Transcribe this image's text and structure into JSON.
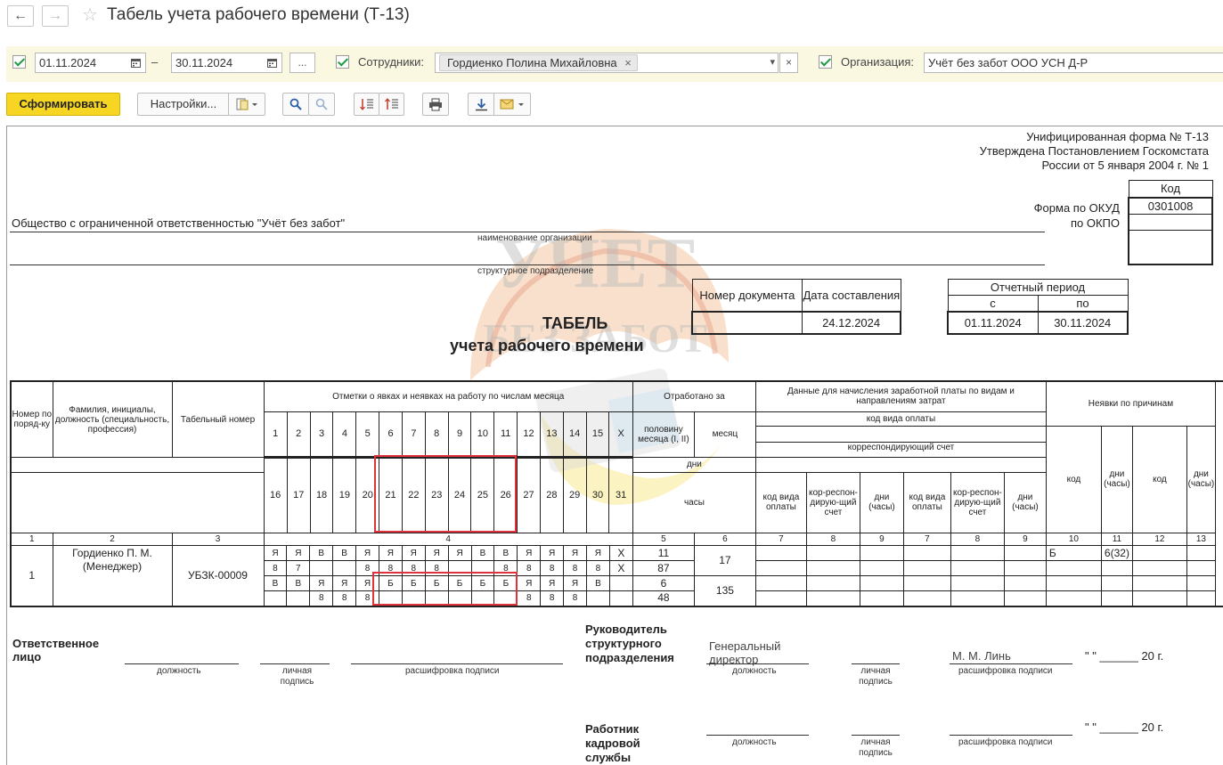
{
  "window": {
    "title": "Табель учета рабочего времени (Т-13)"
  },
  "nav": {
    "back": "←",
    "forward": "→",
    "fav": "☆"
  },
  "filters": {
    "date_from": "01.11.2024",
    "date_sep": "–",
    "date_to": "30.11.2024",
    "period_more": "...",
    "employees_label": "Сотрудники:",
    "employee_tag": "Гордиенко Полина Михайловна",
    "tag_remove": "×",
    "dropdown": "▾",
    "clear": "×",
    "org_label": "Организация:",
    "org_value": "Учёт без забот ООО УСН Д-Р"
  },
  "toolbar": {
    "form": "Сформировать",
    "settings": "Настройки..."
  },
  "report": {
    "form_line1": "Унифицированная форма № Т-13",
    "form_line2": "Утверждена Постановлением Госкомстата",
    "form_line3": "России от 5 января 2004 г. № 1",
    "kod": "Код",
    "okud_label": "Форма по ОКУД",
    "okud_value": "0301008",
    "okpo_label": "по ОКПО",
    "org_name": "Общество с ограниченной ответственностью \"Учёт без забот\"",
    "org_caption": "наименование организации",
    "dept_caption": "структурное подразделение",
    "doc_num_label": "Номер документа",
    "doc_date_label": "Дата составления",
    "doc_date": "24.12.2024",
    "period_label": "Отчетный период",
    "period_from_label": "с",
    "period_to_label": "по",
    "period_from": "01.11.2024",
    "period_to": "30.11.2024",
    "title1": "ТАБЕЛЬ",
    "title2": "учета  рабочего времени"
  },
  "table": {
    "h_num": "Номер по поряд-ку",
    "h_fio": "Фамилия, инициалы, должность (специальность, профессия)",
    "h_tab": "Табельный номер",
    "h_marks": "Отметки о явках и неявках на работу по числам месяца",
    "h_worked": "Отработано за",
    "h_half": "половину месяца (I, II)",
    "h_month": "месяц",
    "h_days": "дни",
    "h_hours": "часы",
    "h_pay": "Данные для начисления заработной платы по видам и направлениям затрат",
    "h_paycode": "код вида оплаты",
    "h_corr": "корреспондирующий счет",
    "h_absent": "Неявки по причинам",
    "h_code_vida": "код вида оплаты",
    "h_korr": "кор-респон-дирую-щий счет",
    "h_dni_chasy": "дни (часы)",
    "h_kod": "код",
    "days_top": [
      "1",
      "2",
      "3",
      "4",
      "5",
      "6",
      "7",
      "8",
      "9",
      "10",
      "11",
      "12",
      "13",
      "14",
      "15",
      "X"
    ],
    "days_bottom": [
      "16",
      "17",
      "18",
      "19",
      "20",
      "21",
      "22",
      "23",
      "24",
      "25",
      "26",
      "27",
      "28",
      "29",
      "30",
      "31"
    ],
    "col_nums": [
      "1",
      "2",
      "3",
      "4",
      "5",
      "6",
      "7",
      "8",
      "9",
      "7",
      "8",
      "9",
      "10",
      "11",
      "12",
      "13"
    ],
    "row": {
      "num": "1",
      "fio": "Гордиенко П. М. (Менеджер)",
      "tab": "УБЗК-00009",
      "marks1": [
        "Я",
        "Я",
        "В",
        "В",
        "Я",
        "Я",
        "Я",
        "Я",
        "Я",
        "В",
        "В",
        "Я",
        "Я",
        "Я",
        "Я",
        "X"
      ],
      "hours1": [
        "8",
        "7",
        "",
        "",
        "8",
        "8",
        "8",
        "8",
        "",
        "",
        "8",
        "8",
        "8",
        "8",
        "8",
        "X"
      ],
      "marks2": [
        "В",
        "В",
        "Я",
        "Я",
        "Я",
        "Б",
        "Б",
        "Б",
        "Б",
        "Б",
        "Б",
        "Я",
        "Я",
        "Я",
        "В",
        ""
      ],
      "hours2": [
        "",
        "",
        "8",
        "8",
        "8",
        "",
        "",
        "",
        "",
        "",
        "",
        "8",
        "8",
        "8",
        "",
        ""
      ],
      "half1_days": "11",
      "half1_hours": "87",
      "half2_days": "6",
      "half2_hours": "48",
      "month_days": "17",
      "month_hours": "135",
      "abs_code": "Б",
      "abs_days": "6(32)"
    }
  },
  "signatures": {
    "responsible": "Ответственное лицо",
    "position_caption": "должность",
    "sign_caption": "личная подпись",
    "decode_caption": "расшифровка подписи",
    "head": "Руководитель структурного подразделения",
    "head_position": "Генеральный директор",
    "head_name": "М. М. Линь",
    "date_stub": "\" \" ______ 20   г.",
    "hr": "Работник кадровой службы"
  },
  "watermark": {
    "line1": "УЧЕТ",
    "line2": "БЕЗ ЗАБОТ"
  },
  "colors": {
    "accent": "#f7d623",
    "filterbar": "#fbf8e2",
    "highlight": "#e0323a"
  }
}
